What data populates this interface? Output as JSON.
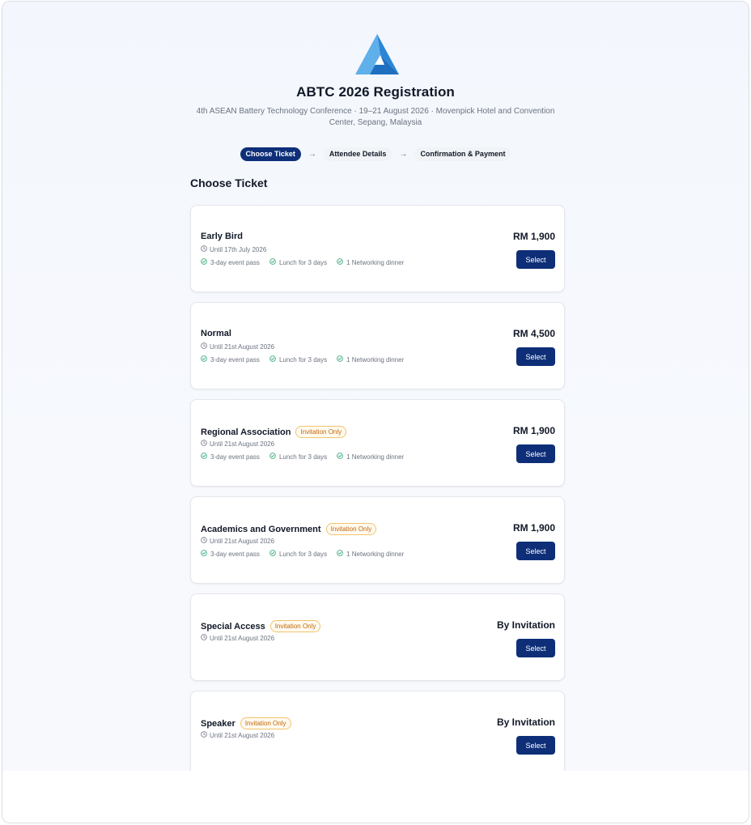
{
  "header": {
    "title": "ABTC 2026 Registration",
    "subtitle": "4th ASEAN Battery Technology Conference · 19–21 August 2026 · Movenpick Hotel and Convention Center, Sepang, Malaysia",
    "logo_icon": "triangle-logo-icon"
  },
  "steps": [
    {
      "label": "Choose Ticket",
      "active": true
    },
    {
      "label": "Attendee Details",
      "active": false
    },
    {
      "label": "Confirmation & Payment",
      "active": false
    }
  ],
  "section_title": "Choose Ticket",
  "tickets": [
    {
      "name": "Early Bird",
      "badge": "",
      "until": "Until 17th July 2026",
      "features": [
        "3-day event pass",
        "Lunch for 3 days",
        "1 Networking dinner"
      ],
      "price": "RM 1,900",
      "select_label": "Select"
    },
    {
      "name": "Normal",
      "badge": "",
      "until": "Until 21st August 2026",
      "features": [
        "3-day event pass",
        "Lunch for 3 days",
        "1 Networking dinner"
      ],
      "price": "RM 4,500",
      "select_label": "Select"
    },
    {
      "name": "Regional Association",
      "badge": "Invitation Only",
      "until": "Until 21st August 2026",
      "features": [
        "3-day event pass",
        "Lunch for 3 days",
        "1 Networking dinner"
      ],
      "price": "RM 1,900",
      "select_label": "Select"
    },
    {
      "name": "Academics and Government",
      "badge": "Invitation Only",
      "until": "Until 21st August 2026",
      "features": [
        "3-day event pass",
        "Lunch for 3 days",
        "1 Networking dinner"
      ],
      "price": "RM 1,900",
      "select_label": "Select"
    },
    {
      "name": "Special Access",
      "badge": "Invitation Only",
      "until": "Until 21st August 2026",
      "features": [],
      "price": "By Invitation",
      "select_label": "Select"
    },
    {
      "name": "Speaker",
      "badge": "Invitation Only",
      "until": "Until 21st August 2026",
      "features": [],
      "price": "By Invitation",
      "select_label": "Select"
    }
  ],
  "colors": {
    "primary": "#0e2f78",
    "badge_text": "#c2670b",
    "badge_border": "#f2c36b",
    "check": "#22a06b",
    "logo_light": "#5fb0ea",
    "logo_dark": "#1f6fc0"
  }
}
